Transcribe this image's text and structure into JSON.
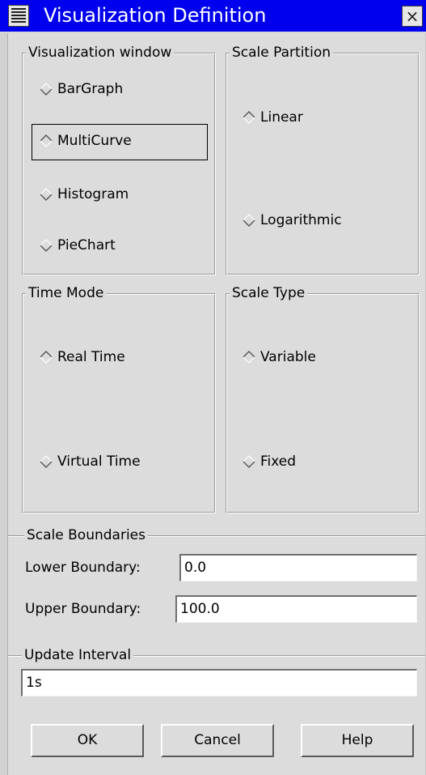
{
  "window": {
    "title": "Visualization Definition",
    "close_glyph": "×"
  },
  "visualization_window": {
    "legend": "Visualization window",
    "options": [
      "BarGraph",
      "MultiCurve",
      "Histogram",
      "PieChart"
    ],
    "selected": "MultiCurve"
  },
  "scale_partition": {
    "legend": "Scale Partition",
    "options": [
      "Linear",
      "Logarithmic"
    ],
    "selected": "Linear"
  },
  "time_mode": {
    "legend": "Time Mode",
    "options": [
      "Real Time",
      "Virtual Time"
    ],
    "selected": "Real Time"
  },
  "scale_type": {
    "legend": "Scale Type",
    "options": [
      "Variable",
      "Fixed"
    ],
    "selected": "Variable"
  },
  "scale_boundaries": {
    "legend": "Scale Boundaries",
    "lower_label": "Lower Boundary:",
    "lower_value": "0.0",
    "upper_label": "Upper Boundary:",
    "upper_value": "100.0"
  },
  "update_interval": {
    "legend": "Update Interval",
    "value": "1s"
  },
  "buttons": {
    "ok": "OK",
    "cancel": "Cancel",
    "help": "Help"
  },
  "colors": {
    "titlebar": "#0000ee",
    "background": "#dcdcdc",
    "field": "#ffffff"
  }
}
